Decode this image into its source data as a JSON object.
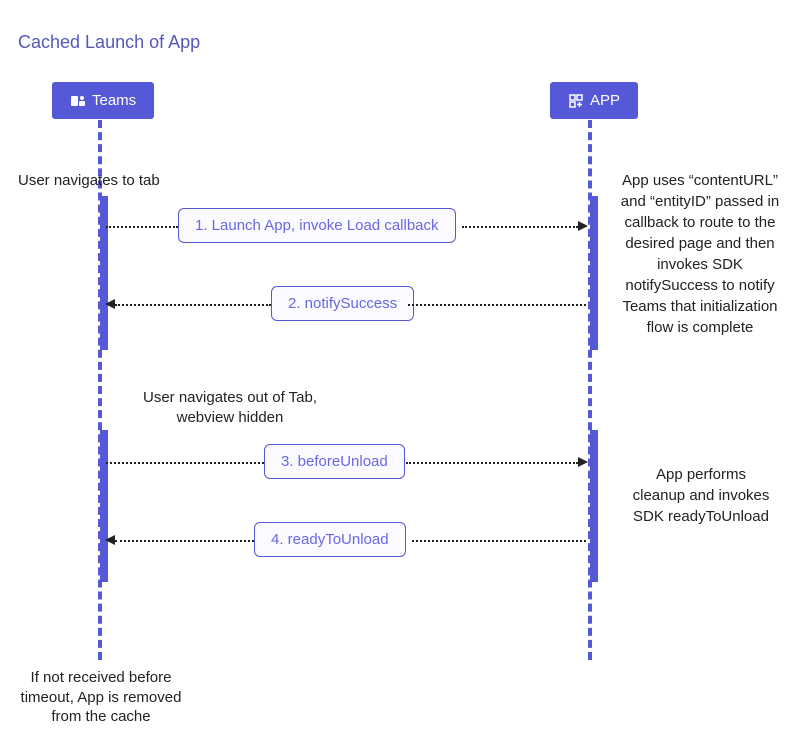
{
  "title": "Cached Launch of App",
  "actors": {
    "teams": "Teams",
    "app": "APP"
  },
  "messages": {
    "m1": "1. Launch App, invoke Load callback",
    "m2": "2. notifySuccess",
    "m3": "3. beforeUnload",
    "m4": "4. readyToUnload"
  },
  "notes": {
    "nav_to_tab": "User navigates to tab",
    "app_uses": "App uses “contentURL” and “entityID” passed in callback to route to the desired page and then invokes SDK notifySuccess to notify Teams that initialization flow is complete",
    "nav_out": "User navigates out of Tab,\nwebview hidden",
    "cleanup": "App performs cleanup and invokes SDK readyToUnload",
    "timeout": "If not received before timeout, App is removed from the cache"
  },
  "chart_data": {
    "type": "sequence-diagram",
    "title": "Cached Launch of App",
    "actors": [
      "Teams",
      "APP"
    ],
    "events": [
      {
        "type": "note",
        "over": "Teams",
        "text": "User navigates to tab"
      },
      {
        "type": "message",
        "from": "Teams",
        "to": "APP",
        "label": "1. Launch App, invoke Load callback"
      },
      {
        "type": "note",
        "over": "APP",
        "text": "App uses \"contentURL\" and \"entityID\" passed in callback to route to the desired page and then invokes SDK notifySuccess to notify Teams that initialization flow is complete"
      },
      {
        "type": "message",
        "from": "APP",
        "to": "Teams",
        "label": "2. notifySuccess"
      },
      {
        "type": "note",
        "over": "Teams",
        "text": "User navigates out of Tab, webview hidden"
      },
      {
        "type": "message",
        "from": "Teams",
        "to": "APP",
        "label": "3. beforeUnload"
      },
      {
        "type": "note",
        "over": "APP",
        "text": "App performs cleanup and invokes SDK readyToUnload"
      },
      {
        "type": "message",
        "from": "APP",
        "to": "Teams",
        "label": "4. readyToUnload"
      },
      {
        "type": "note",
        "over": "Teams",
        "text": "If not received before timeout, App is removed from the cache"
      }
    ]
  }
}
